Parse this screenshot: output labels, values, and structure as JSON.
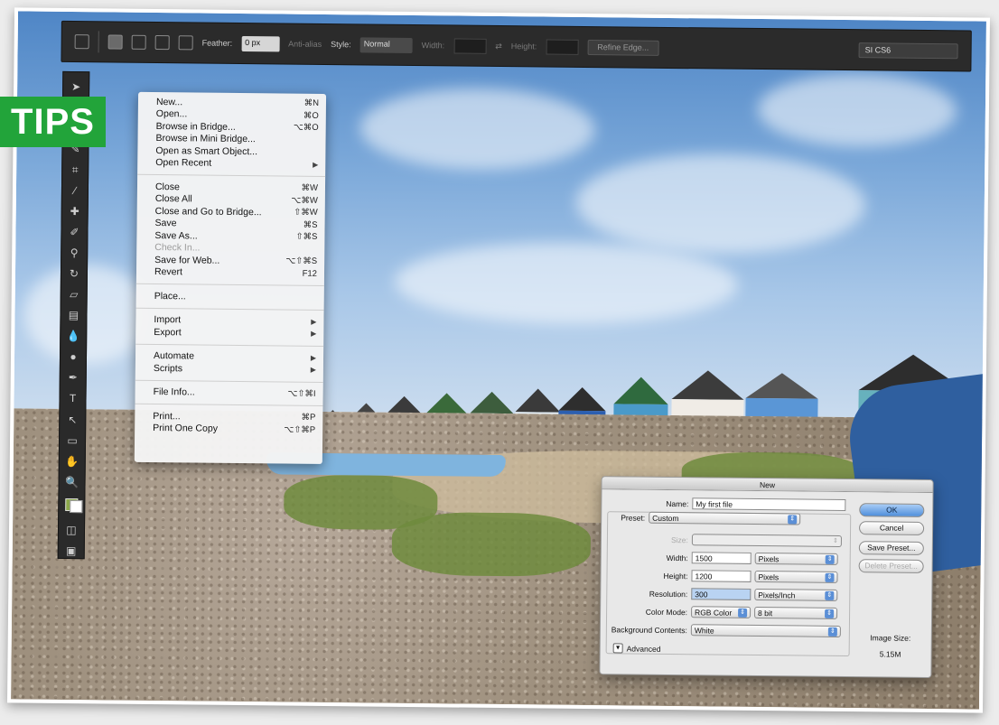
{
  "badge": {
    "label": "TIPS"
  },
  "options_bar": {
    "feather_label": "Feather:",
    "feather_value": "0 px",
    "anti_alias_label": "Anti-alias",
    "style_label": "Style:",
    "style_value": "Normal",
    "width_label": "Width:",
    "height_label": "Height:",
    "refine_edge_label": "Refine Edge...",
    "workspace_value": "SI CS6"
  },
  "file_menu": {
    "groups": [
      [
        {
          "label": "New...",
          "shortcut": "⌘N"
        },
        {
          "label": "Open...",
          "shortcut": "⌘O"
        },
        {
          "label": "Browse in Bridge...",
          "shortcut": "⌥⌘O"
        },
        {
          "label": "Browse in Mini Bridge...",
          "shortcut": ""
        },
        {
          "label": "Open as Smart Object...",
          "shortcut": ""
        },
        {
          "label": "Open Recent",
          "shortcut": "▶"
        }
      ],
      [
        {
          "label": "Close",
          "shortcut": "⌘W"
        },
        {
          "label": "Close All",
          "shortcut": "⌥⌘W"
        },
        {
          "label": "Close and Go to Bridge...",
          "shortcut": "⇧⌘W"
        },
        {
          "label": "Save",
          "shortcut": "⌘S"
        },
        {
          "label": "Save As...",
          "shortcut": "⇧⌘S"
        },
        {
          "label": "Check In...",
          "shortcut": ""
        },
        {
          "label": "Save for Web...",
          "shortcut": "⌥⇧⌘S"
        },
        {
          "label": "Revert",
          "shortcut": "F12"
        }
      ],
      [
        {
          "label": "Place...",
          "shortcut": ""
        }
      ],
      [
        {
          "label": "Import",
          "shortcut": "▶"
        },
        {
          "label": "Export",
          "shortcut": "▶"
        }
      ],
      [
        {
          "label": "Automate",
          "shortcut": "▶"
        },
        {
          "label": "Scripts",
          "shortcut": "▶"
        }
      ],
      [
        {
          "label": "File Info...",
          "shortcut": "⌥⇧⌘I"
        }
      ],
      [
        {
          "label": "Print...",
          "shortcut": "⌘P"
        },
        {
          "label": "Print One Copy",
          "shortcut": "⌥⇧⌘P"
        }
      ]
    ]
  },
  "new_dialog": {
    "title": "New",
    "name_label": "Name:",
    "name_value": "My first file",
    "preset_label": "Preset:",
    "preset_value": "Custom",
    "size_label": "Size:",
    "width_label": "Width:",
    "width_value": "1500",
    "width_unit": "Pixels",
    "height_label": "Height:",
    "height_value": "1200",
    "height_unit": "Pixels",
    "resolution_label": "Resolution:",
    "resolution_value": "300",
    "resolution_unit": "Pixels/Inch",
    "color_mode_label": "Color Mode:",
    "color_mode_value": "RGB Color",
    "bit_depth_value": "8 bit",
    "background_label": "Background Contents:",
    "background_value": "White",
    "advanced_label": "Advanced",
    "ok_label": "OK",
    "cancel_label": "Cancel",
    "save_preset_label": "Save Preset...",
    "delete_preset_label": "Delete Preset...",
    "image_size_label": "Image Size:",
    "image_size_value": "5.15M"
  }
}
